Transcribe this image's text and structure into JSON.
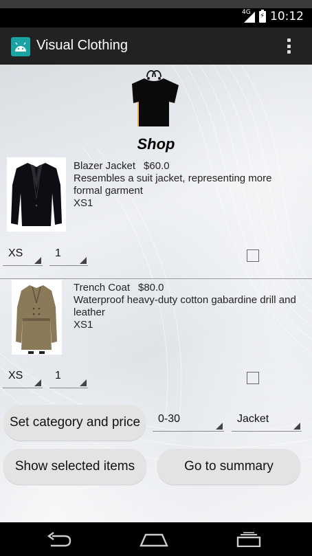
{
  "status_bar": {
    "network": "4G",
    "time": "10:12"
  },
  "app_bar": {
    "title": "Visual Clothing",
    "icon": "android-icon",
    "menu_icon": "overflow-menu-icon"
  },
  "shop": {
    "title": "Shop",
    "logo_icon": "shopping-bag-shirt-icon"
  },
  "items": [
    {
      "name": "Blazer Jacket",
      "price": "$60.0",
      "description": "Resembles a suit jacket, representing more formal garment",
      "size": "XS1",
      "size_spinner": "XS",
      "quantity_spinner": "1",
      "checked": false
    },
    {
      "name": "Trench Coat",
      "price": "$80.0",
      "description": "Waterproof heavy-duty cotton gabardine drill and leather",
      "size": "XS1",
      "size_spinner": "XS",
      "quantity_spinner": "1",
      "checked": false
    }
  ],
  "filters": {
    "set_category_label": "Set category and price",
    "price_range": "0-30",
    "category": "Jacket"
  },
  "actions": {
    "show_selected_label": "Show selected items",
    "summary_label": "Go to summary"
  },
  "nav_bar": {
    "back_icon": "back-icon",
    "home_icon": "home-icon",
    "recents_icon": "recents-icon"
  }
}
